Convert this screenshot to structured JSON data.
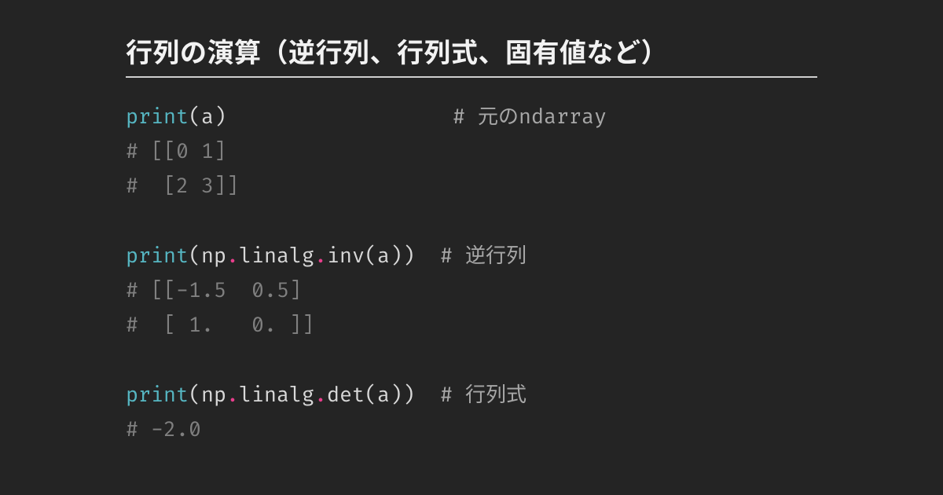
{
  "title": "行列の演算（逆行列、行列式、固有値など）",
  "code": {
    "lines": [
      [
        {
          "cls": "tok-fn",
          "t": "print"
        },
        {
          "cls": "tok-pn",
          "t": "(a)                  "
        },
        {
          "cls": "tok-ccom",
          "t": "# 元のndarray"
        }
      ],
      [
        {
          "cls": "tok-com",
          "t": "# [[0 1]"
        }
      ],
      [
        {
          "cls": "tok-com",
          "t": "#  [2 3]]"
        }
      ],
      [
        {
          "cls": "tok-pn",
          "t": ""
        }
      ],
      [
        {
          "cls": "tok-fn",
          "t": "print"
        },
        {
          "cls": "tok-pn",
          "t": "(np"
        },
        {
          "cls": "tok-dot",
          "t": "."
        },
        {
          "cls": "tok-pn",
          "t": "linalg"
        },
        {
          "cls": "tok-dot",
          "t": "."
        },
        {
          "cls": "tok-pn",
          "t": "inv(a))  "
        },
        {
          "cls": "tok-ccom",
          "t": "# 逆行列"
        }
      ],
      [
        {
          "cls": "tok-com",
          "t": "# [[-1.5  0.5]"
        }
      ],
      [
        {
          "cls": "tok-com",
          "t": "#  [ 1.   0. ]]"
        }
      ],
      [
        {
          "cls": "tok-pn",
          "t": ""
        }
      ],
      [
        {
          "cls": "tok-fn",
          "t": "print"
        },
        {
          "cls": "tok-pn",
          "t": "(np"
        },
        {
          "cls": "tok-dot",
          "t": "."
        },
        {
          "cls": "tok-pn",
          "t": "linalg"
        },
        {
          "cls": "tok-dot",
          "t": "."
        },
        {
          "cls": "tok-pn",
          "t": "det(a))  "
        },
        {
          "cls": "tok-ccom",
          "t": "# 行列式"
        }
      ],
      [
        {
          "cls": "tok-com",
          "t": "# -2.0"
        }
      ]
    ]
  }
}
